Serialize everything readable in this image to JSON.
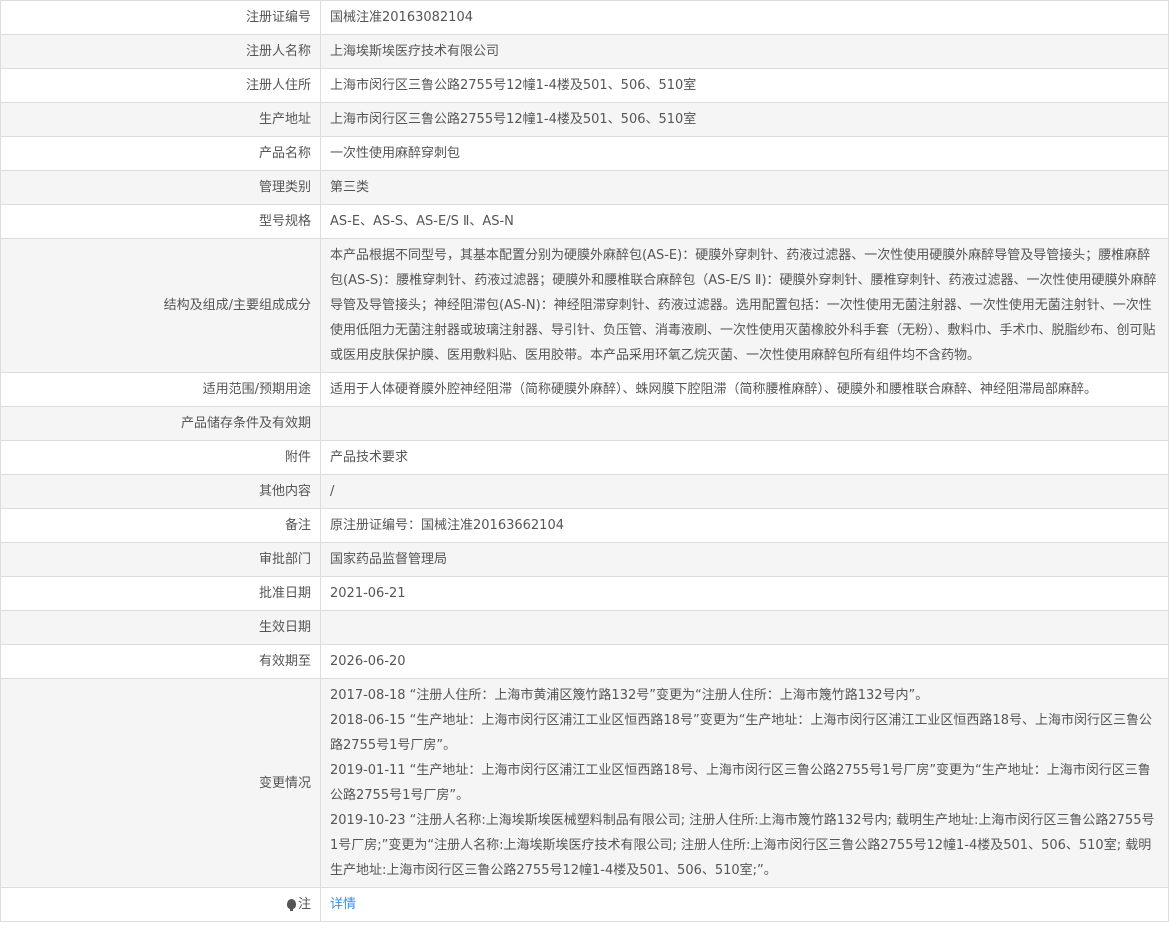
{
  "rows": [
    {
      "label": "注册证编号",
      "value": "国械注准20163082104"
    },
    {
      "label": "注册人名称",
      "value": "上海埃斯埃医疗技术有限公司"
    },
    {
      "label": "注册人住所",
      "value": "上海市闵行区三鲁公路2755号12幢1-4楼及501、506、510室"
    },
    {
      "label": "生产地址",
      "value": "上海市闵行区三鲁公路2755号12幢1-4楼及501、506、510室"
    },
    {
      "label": "产品名称",
      "value": "一次性使用麻醉穿刺包"
    },
    {
      "label": "管理类别",
      "value": "第三类"
    },
    {
      "label": "型号规格",
      "value": "AS-E、AS-S、AS-E/S Ⅱ、AS-N"
    },
    {
      "label": "结构及组成/主要组成成分",
      "value": "本产品根据不同型号，其基本配置分别为硬膜外麻醉包(AS-E)：硬膜外穿刺针、药液过滤器、一次性使用硬膜外麻醉导管及导管接头；腰椎麻醉包(AS-S)：腰椎穿刺针、药液过滤器；硬膜外和腰椎联合麻醉包（AS-E/S Ⅱ)：硬膜外穿刺针、腰椎穿刺针、药液过滤器、一次性使用硬膜外麻醉导管及导管接头；神经阻滞包(AS-N)：神经阻滞穿刺针、药液过滤器。选用配置包括：一次性使用无菌注射器、一次性使用无菌注射针、一次性使用低阻力无菌注射器或玻璃注射器、导引针、负压管、消毒液刷、一次性使用灭菌橡胶外科手套（无粉）、敷料巾、手术巾、脱脂纱布、创可贴或医用皮肤保护膜、医用敷料贴、医用胶带。本产品采用环氧乙烷灭菌、一次性使用麻醉包所有组件均不含药物。"
    },
    {
      "label": "适用范围/预期用途",
      "value": "适用于人体硬脊膜外腔神经阻滞（简称硬膜外麻醉）、蛛网膜下腔阻滞（简称腰椎麻醉）、硬膜外和腰椎联合麻醉、神经阻滞局部麻醉。"
    },
    {
      "label": "产品储存条件及有效期",
      "value": ""
    },
    {
      "label": "附件",
      "value": "产品技术要求"
    },
    {
      "label": "其他内容",
      "value": "/"
    },
    {
      "label": "备注",
      "value": "原注册证编号：国械注准20163662104"
    },
    {
      "label": "审批部门",
      "value": "国家药品监督管理局"
    },
    {
      "label": "批准日期",
      "value": "2021-06-21"
    },
    {
      "label": "生效日期",
      "value": ""
    },
    {
      "label": "有效期至",
      "value": "2026-06-20"
    }
  ],
  "changes": {
    "label": "变更情况",
    "items": [
      "2017-08-18 “注册人住所：上海市黄浦区篾竹路132号”变更为“注册人住所：上海市篾竹路132号内”。",
      "2018-06-15 “生产地址：上海市闵行区浦江工业区恒西路18号”变更为“生产地址：上海市闵行区浦江工业区恒西路18号、上海市闵行区三鲁公路2755号1号厂房”。",
      "2019-01-11 “生产地址：上海市闵行区浦江工业区恒西路18号、上海市闵行区三鲁公路2755号1号厂房”变更为“生产地址：上海市闵行区三鲁公路2755号1号厂房”。",
      "2019-10-23 “注册人名称:上海埃斯埃医械塑料制品有限公司; 注册人住所:上海市篾竹路132号内; 载明生产地址:上海市闵行区三鲁公路2755号1号厂房;”变更为“注册人名称:上海埃斯埃医疗技术有限公司; 注册人住所:上海市闵行区三鲁公路2755号12幢1-4楼及501、506、510室; 载明生产地址:上海市闵行区三鲁公路2755号12幢1-4楼及501、506、510室;”。"
    ]
  },
  "note": {
    "label": "注",
    "link": "详情",
    "icon": "lightbulb-icon"
  }
}
